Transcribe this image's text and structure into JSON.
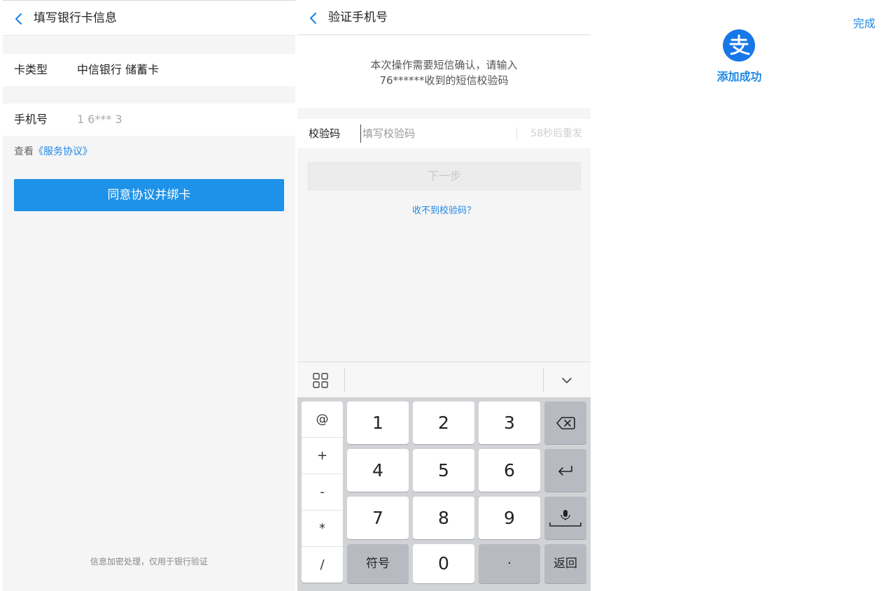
{
  "bind_card": {
    "title": "填写银行卡信息",
    "card_type_label": "卡类型",
    "card_type_value": "中信银行 储蓄卡",
    "phone_label": "手机号",
    "phone_value": "1 6***  3",
    "agreement_prefix": "查看",
    "agreement_link": "《服务协议》",
    "submit_label": "同意协议并绑卡",
    "footer_note": "信息加密处理，仅用于银行验证"
  },
  "verify_phone": {
    "title": "验证手机号",
    "notice_line1": "本次操作需要短信确认，请输入",
    "notice_line2": "76******收到的短信校验码",
    "code_label": "校验码",
    "code_placeholder": "填写校验码",
    "resend_text": "58秒后重发",
    "next_label": "下一步",
    "help_link": "收不到校验码？"
  },
  "keyboard": {
    "symbols": [
      "@",
      "+",
      "-",
      "*",
      "/"
    ],
    "digits": {
      "k1": "1",
      "k2": "2",
      "k3": "3",
      "k4": "4",
      "k5": "5",
      "k6": "6",
      "k7": "7",
      "k8": "8",
      "k9": "9",
      "k0": "0"
    },
    "symbol_switch": "符号",
    "dot": "·",
    "return_label": "返回"
  },
  "success": {
    "done_label": "完成",
    "message": "添加成功"
  },
  "colors": {
    "primary": "#1e92e8",
    "link": "#1e88e5",
    "alipay": "#1677e8"
  }
}
